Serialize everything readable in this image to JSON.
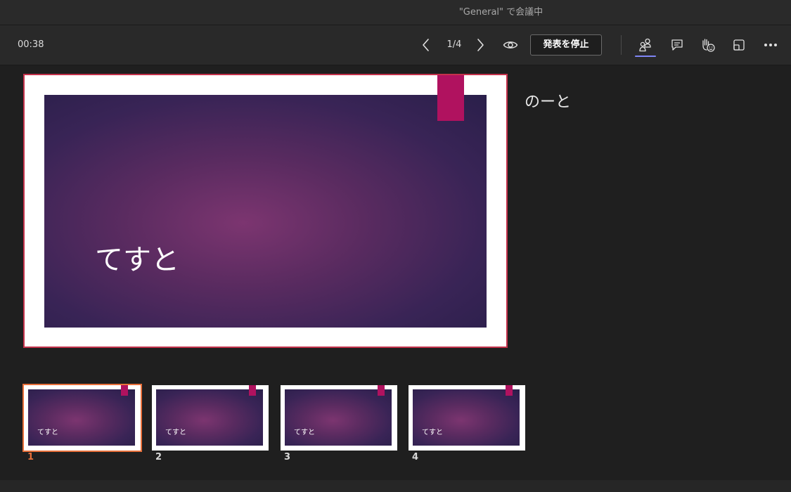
{
  "window": {
    "title": "\"General\" で会議中"
  },
  "toolbar": {
    "timer": "00:38",
    "page_indicator": "1/4",
    "stop_label": "発表を停止",
    "accent_color": "#7f85f5"
  },
  "slide": {
    "title": "てすと",
    "notes": "のーと",
    "accent_color": "#b0125f",
    "selection_color": "#c4314b"
  },
  "thumbnails": [
    {
      "number": "1",
      "title": "てすと",
      "selected": true
    },
    {
      "number": "2",
      "title": "てすと",
      "selected": false
    },
    {
      "number": "3",
      "title": "てすと",
      "selected": false
    },
    {
      "number": "4",
      "title": "てすと",
      "selected": false
    }
  ],
  "icons": {
    "prev": "chevron-left-icon",
    "next": "chevron-right-icon",
    "view": "eye-icon",
    "people": "people-icon",
    "chat": "chat-icon",
    "reactions": "raise-hand-icon",
    "share": "share-tray-icon",
    "more": "more-icon"
  }
}
